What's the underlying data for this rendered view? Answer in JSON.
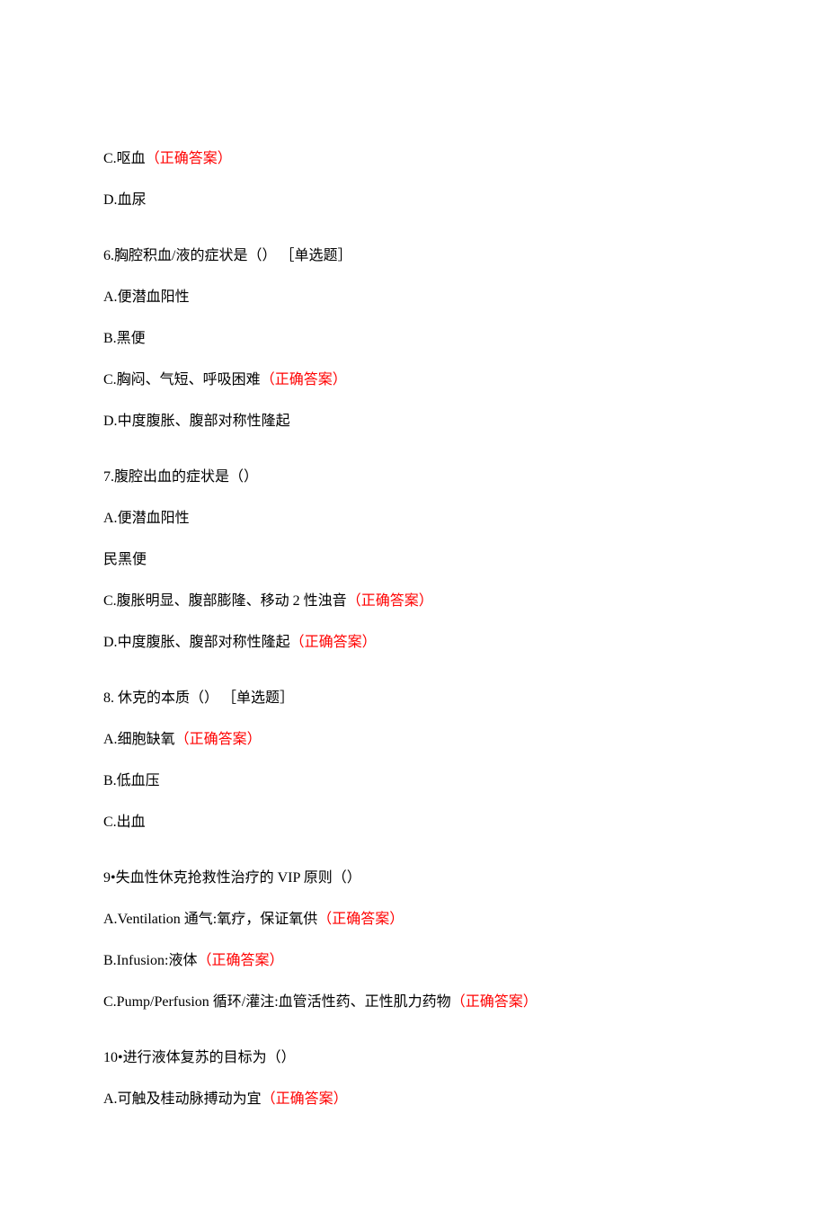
{
  "answer_label": "（正确答案）",
  "q5_partial": {
    "options": [
      {
        "prefix": "C.",
        "text": "呕血",
        "correct": true
      },
      {
        "prefix": "D.",
        "text": "血尿",
        "correct": false
      }
    ]
  },
  "q6": {
    "stem_prefix": "6.",
    "stem": "胸腔积血/液的症状是（） ［单选题］",
    "options": [
      {
        "prefix": "A.",
        "text": "便潜血阳性",
        "correct": false
      },
      {
        "prefix": "B.",
        "text": "黑便",
        "correct": false
      },
      {
        "prefix": "C.",
        "text": "胸闷、气短、呼吸困难",
        "correct": true
      },
      {
        "prefix": "D.",
        "text": "中度腹胀、腹部对称性隆起",
        "correct": false
      }
    ]
  },
  "q7": {
    "stem_prefix": "7.",
    "stem": "腹腔出血的症状是（）",
    "options": [
      {
        "prefix": "A.",
        "text": "便潜血阳性",
        "correct": false
      },
      {
        "prefix": "民",
        "text": "黑便",
        "correct": false
      },
      {
        "prefix": "C.",
        "text": "腹胀明显、腹部膨隆、移动 2 性浊音",
        "correct": true
      },
      {
        "prefix": "D.",
        "text": "中度腹胀、腹部对称性隆起",
        "correct": true
      }
    ]
  },
  "q8": {
    "stem_prefix": "8. ",
    "stem": "休克的本质（） ［单选题］",
    "options": [
      {
        "prefix": "A.",
        "text": "细胞缺氧",
        "correct": true
      },
      {
        "prefix": "B.",
        "text": "低血压",
        "correct": false
      },
      {
        "prefix": "C.",
        "text": "出血",
        "correct": false
      }
    ]
  },
  "q9": {
    "stem_prefix": "9•",
    "stem": "失血性休克抢救性治疗的 VIP 原则（）",
    "options": [
      {
        "prefix": "A.",
        "text": "Ventilation 通气:氧疗，保证氧供",
        "correct": true
      },
      {
        "prefix": "B.",
        "text": "Infusion:液体",
        "correct": true
      },
      {
        "prefix": "C.",
        "text": "Pump/Perfusion 循环/灌注:血管活性药、正性肌力药物",
        "correct": true
      }
    ]
  },
  "q10": {
    "stem_prefix": "10•",
    "stem": "进行液体复苏的目标为（）",
    "options": [
      {
        "prefix": "A.",
        "text": "可触及桂动脉搏动为宜",
        "correct": true
      }
    ]
  }
}
